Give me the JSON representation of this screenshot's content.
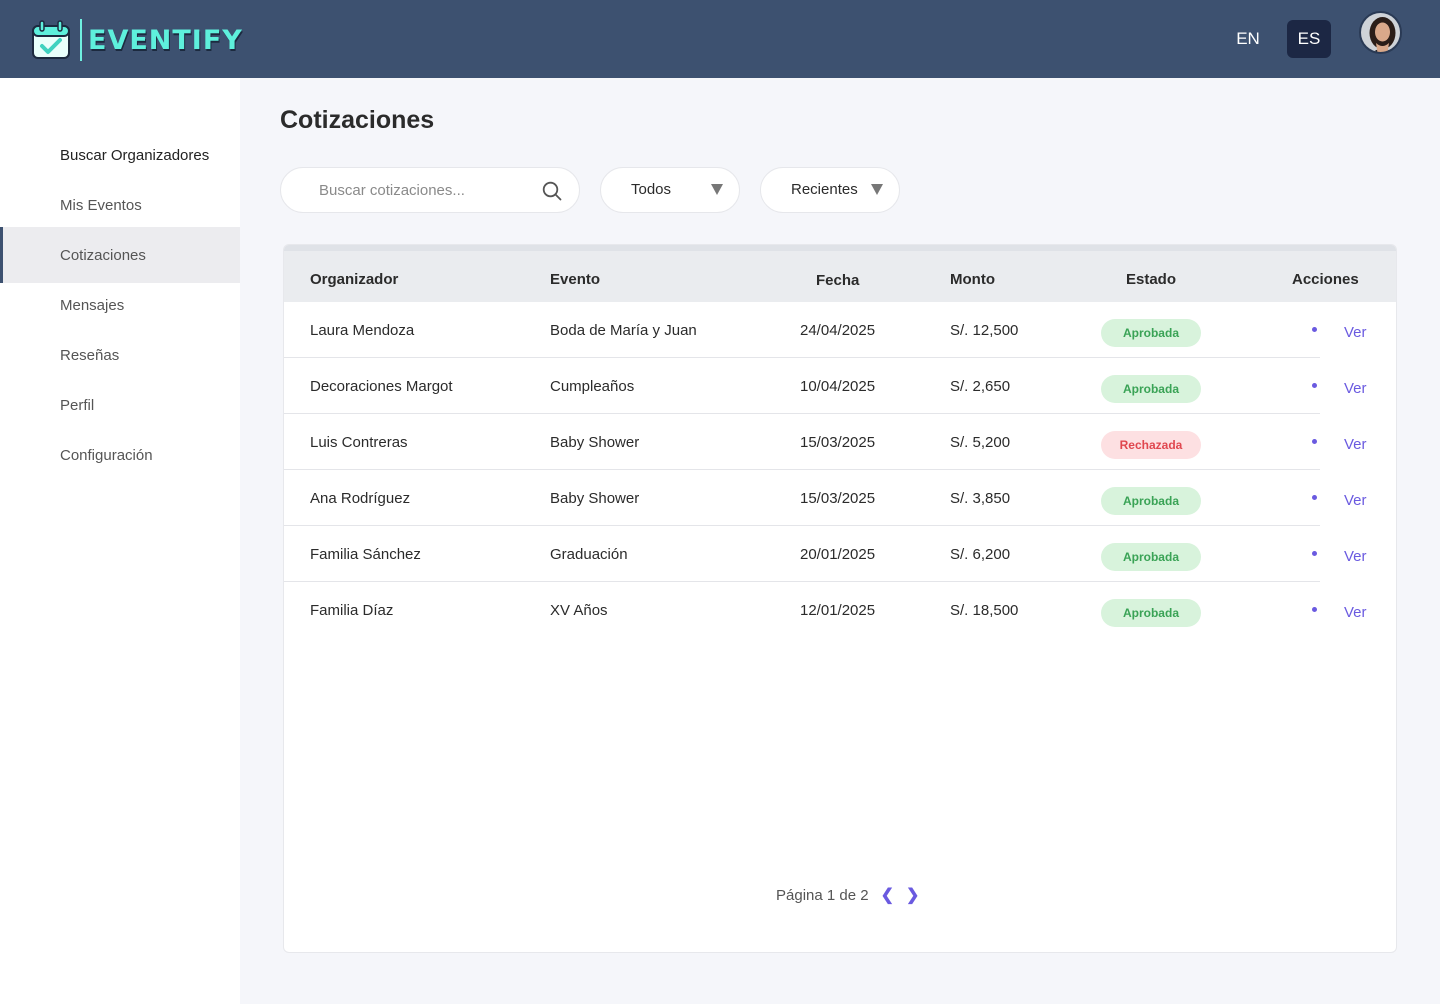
{
  "header": {
    "logo_text": "EVENTIFY",
    "lang_en": "EN",
    "lang_es": "ES",
    "active_lang": "ES"
  },
  "sidebar": {
    "items": [
      {
        "label": "Buscar Organizadores"
      },
      {
        "label": "Mis Eventos"
      },
      {
        "label": "Cotizaciones"
      },
      {
        "label": "Mensajes"
      },
      {
        "label": "Reseñas"
      },
      {
        "label": "Perfil"
      },
      {
        "label": "Configuración"
      }
    ],
    "active": "Cotizaciones"
  },
  "main": {
    "title": "Cotizaciones",
    "search_placeholder": "Buscar cotizaciones...",
    "filter_status": "Todos",
    "filter_sort": "Recientes"
  },
  "table": {
    "headers": {
      "organizador": "Organizador",
      "evento": "Evento",
      "fecha": "Fecha",
      "monto": "Monto",
      "estado": "Estado",
      "acciones": "Acciones"
    },
    "rows": [
      {
        "organizador": "Laura Mendoza",
        "evento": "Boda de María y Juan",
        "fecha": "24/04/2025",
        "monto": "S/. 12,500",
        "estado": "Aprobada",
        "accion": "Ver"
      },
      {
        "organizador": "Decoraciones Margot",
        "evento": "Cumpleaños",
        "fecha": "10/04/2025",
        "monto": "S/. 2,650",
        "estado": "Aprobada",
        "accion": "Ver"
      },
      {
        "organizador": "Luis Contreras",
        "evento": "Baby Shower",
        "fecha": "15/03/2025",
        "monto": "S/. 5,200",
        "estado": "Rechazada",
        "accion": "Ver"
      },
      {
        "organizador": "Ana Rodríguez",
        "evento": "Baby Shower",
        "fecha": "15/03/2025",
        "monto": "S/. 3,850",
        "estado": "Aprobada",
        "accion": "Ver"
      },
      {
        "organizador": "Familia Sánchez",
        "evento": "Graduación",
        "fecha": "20/01/2025",
        "monto": "S/. 6,200",
        "estado": "Aprobada",
        "accion": "Ver"
      },
      {
        "organizador": "Familia Díaz",
        "evento": "XV Años",
        "fecha": "12/01/2025",
        "monto": "S/. 18,500",
        "estado": "Aprobada",
        "accion": "Ver"
      }
    ]
  },
  "pagination": {
    "label": "Página 1 de 2",
    "prev": "❮",
    "next": "❯"
  },
  "colors": {
    "header_bg": "#3d5170",
    "accent": "#6a5ae0",
    "approved_bg": "#d8f3dc",
    "approved_text": "#3aa356",
    "rejected_bg": "#fde0e2",
    "rejected_text": "#e0474f"
  },
  "icons": [
    "calendar-check-icon",
    "search-icon",
    "chevron-down-icon",
    "chevron-left-icon",
    "chevron-right-icon"
  ]
}
